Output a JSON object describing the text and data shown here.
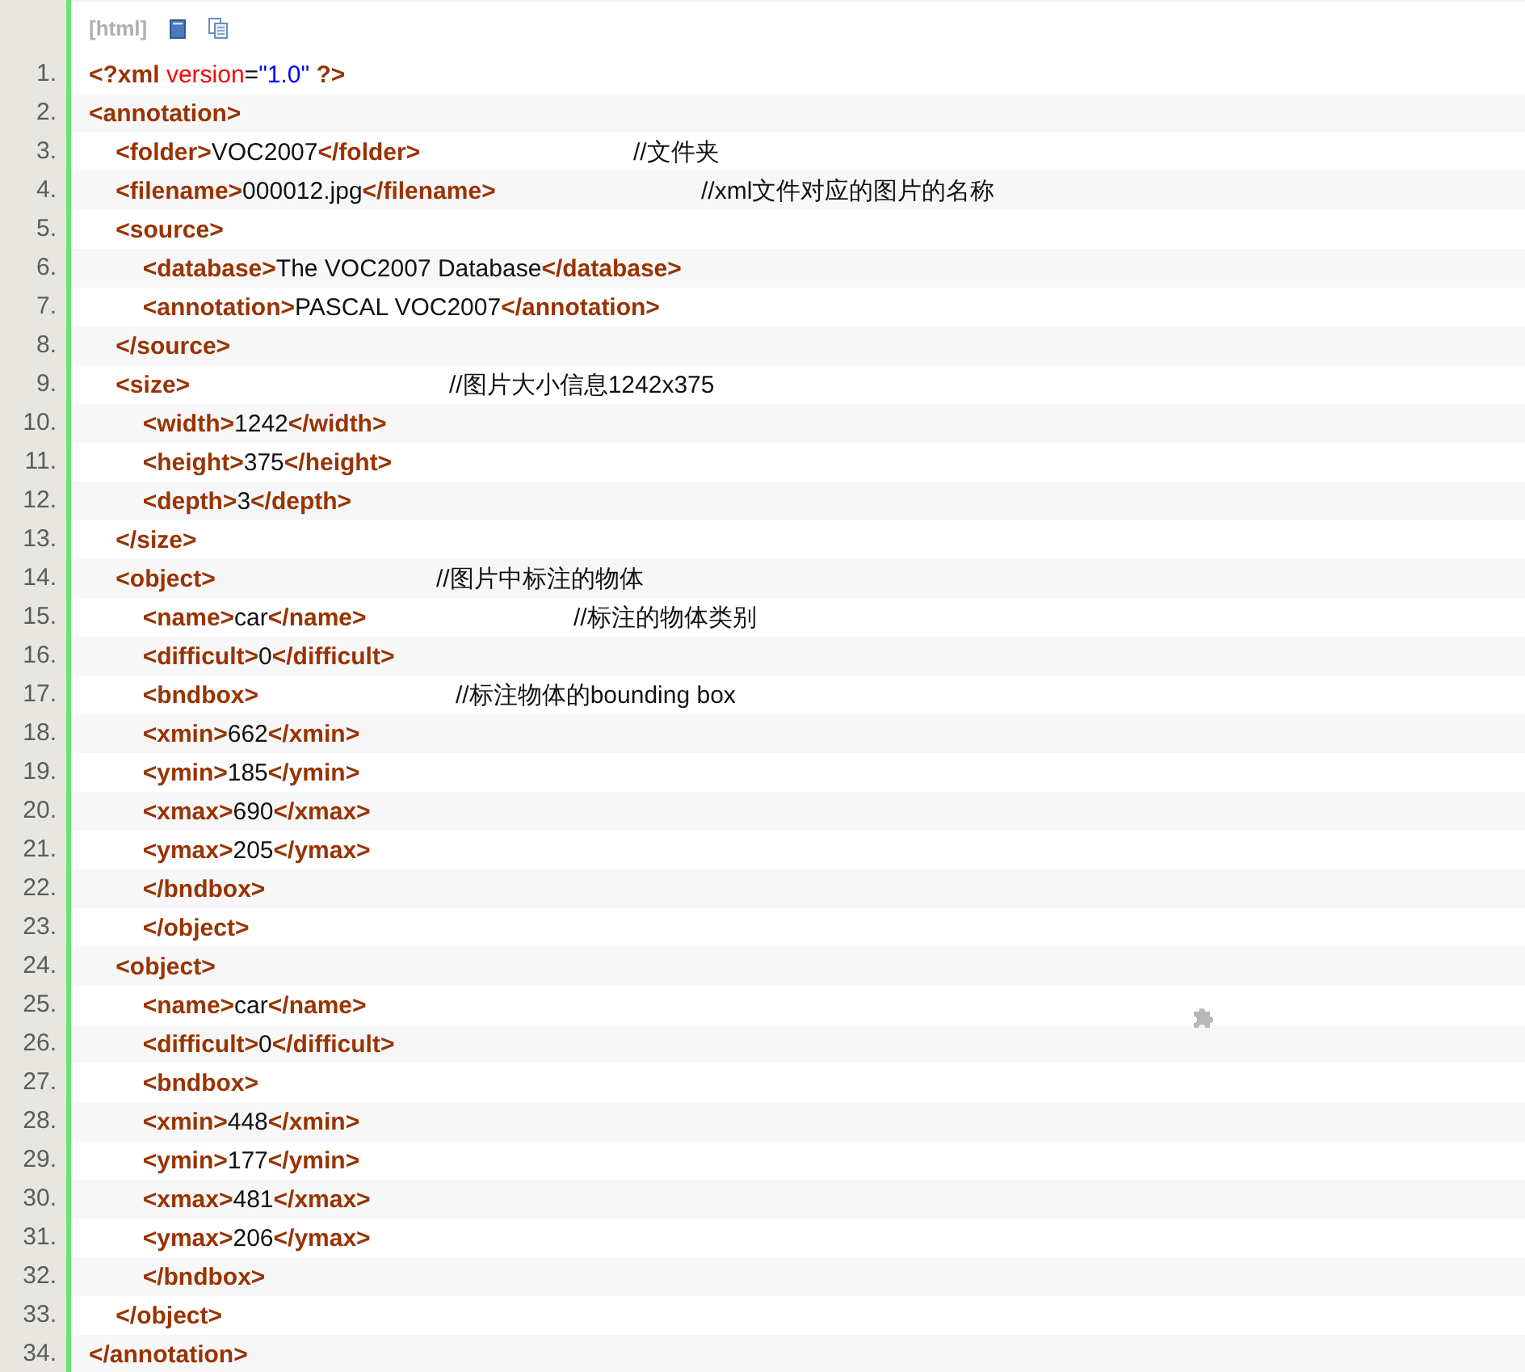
{
  "toolbar": {
    "language": "[html]"
  },
  "lines": [
    {
      "number": "1.",
      "code": [
        {
          "kind": "tag",
          "text": "<?xml "
        },
        {
          "kind": "attr",
          "text": "version"
        },
        {
          "kind": "plain",
          "text": "="
        },
        {
          "kind": "value",
          "text": "\"1.0\""
        },
        {
          "kind": "tag",
          "text": " ?>"
        }
      ]
    },
    {
      "number": "2.",
      "code": [
        {
          "kind": "tag",
          "text": "<annotation>"
        }
      ]
    },
    {
      "number": "3.",
      "code": [
        {
          "kind": "tag",
          "text": "    <folder>"
        },
        {
          "kind": "text",
          "text": "VOC2007"
        },
        {
          "kind": "tag",
          "text": "</folder>"
        }
      ],
      "comment": "//文件夹"
    },
    {
      "number": "4.",
      "code": [
        {
          "kind": "tag",
          "text": "    <filename>"
        },
        {
          "kind": "text",
          "text": "000012.jpg"
        },
        {
          "kind": "tag",
          "text": "</filename>"
        }
      ],
      "comment": "//xml文件对应的图片的名称"
    },
    {
      "number": "5.",
      "code": [
        {
          "kind": "tag",
          "text": "    <source>"
        }
      ]
    },
    {
      "number": "6.",
      "code": [
        {
          "kind": "tag",
          "text": "        <database>"
        },
        {
          "kind": "text",
          "text": "The VOC2007 Database"
        },
        {
          "kind": "tag",
          "text": "</database>"
        }
      ]
    },
    {
      "number": "7.",
      "code": [
        {
          "kind": "tag",
          "text": "        <annotation>"
        },
        {
          "kind": "text",
          "text": "PASCAL VOC2007"
        },
        {
          "kind": "tag",
          "text": "</annotation>"
        }
      ]
    },
    {
      "number": "8.",
      "code": [
        {
          "kind": "tag",
          "text": "    </source>"
        }
      ]
    },
    {
      "number": "9.",
      "code": [
        {
          "kind": "tag",
          "text": "    <size>"
        }
      ],
      "comment": "//图片大小信息1242x375"
    },
    {
      "number": "10.",
      "code": [
        {
          "kind": "tag",
          "text": "        <width>"
        },
        {
          "kind": "text",
          "text": "1242"
        },
        {
          "kind": "tag",
          "text": "</width>"
        }
      ]
    },
    {
      "number": "11.",
      "code": [
        {
          "kind": "tag",
          "text": "        <height>"
        },
        {
          "kind": "text",
          "text": "375"
        },
        {
          "kind": "tag",
          "text": "</height>"
        }
      ]
    },
    {
      "number": "12.",
      "code": [
        {
          "kind": "tag",
          "text": "        <depth>"
        },
        {
          "kind": "text",
          "text": "3"
        },
        {
          "kind": "tag",
          "text": "</depth>"
        }
      ]
    },
    {
      "number": "13.",
      "code": [
        {
          "kind": "tag",
          "text": "    </size>"
        }
      ]
    },
    {
      "number": "14.",
      "code": [
        {
          "kind": "tag",
          "text": "    <object>"
        }
      ],
      "comment": "//图片中标注的物体"
    },
    {
      "number": "15.",
      "code": [
        {
          "kind": "tag",
          "text": "        <name>"
        },
        {
          "kind": "text",
          "text": "car"
        },
        {
          "kind": "tag",
          "text": "</name>"
        }
      ],
      "comment": "//标注的物体类别"
    },
    {
      "number": "16.",
      "code": [
        {
          "kind": "tag",
          "text": "        <difficult>"
        },
        {
          "kind": "text",
          "text": "0"
        },
        {
          "kind": "tag",
          "text": "</difficult>"
        }
      ]
    },
    {
      "number": "17.",
      "code": [
        {
          "kind": "tag",
          "text": "        <bndbox>"
        }
      ],
      "comment": "//标注物体的bounding box"
    },
    {
      "number": "18.",
      "code": [
        {
          "kind": "tag",
          "text": "        <xmin>"
        },
        {
          "kind": "text",
          "text": "662"
        },
        {
          "kind": "tag",
          "text": "</xmin>"
        }
      ]
    },
    {
      "number": "19.",
      "code": [
        {
          "kind": "tag",
          "text": "        <ymin>"
        },
        {
          "kind": "text",
          "text": "185"
        },
        {
          "kind": "tag",
          "text": "</ymin>"
        }
      ]
    },
    {
      "number": "20.",
      "code": [
        {
          "kind": "tag",
          "text": "        <xmax>"
        },
        {
          "kind": "text",
          "text": "690"
        },
        {
          "kind": "tag",
          "text": "</xmax>"
        }
      ]
    },
    {
      "number": "21.",
      "code": [
        {
          "kind": "tag",
          "text": "        <ymax>"
        },
        {
          "kind": "text",
          "text": "205"
        },
        {
          "kind": "tag",
          "text": "</ymax>"
        }
      ]
    },
    {
      "number": "22.",
      "code": [
        {
          "kind": "tag",
          "text": "        </bndbox>"
        }
      ]
    },
    {
      "number": "23.",
      "code": [
        {
          "kind": "tag",
          "text": "        </object>"
        }
      ]
    },
    {
      "number": "24.",
      "code": [
        {
          "kind": "tag",
          "text": "    <object>"
        }
      ]
    },
    {
      "number": "25.",
      "code": [
        {
          "kind": "tag",
          "text": "        <name>"
        },
        {
          "kind": "text",
          "text": "car"
        },
        {
          "kind": "tag",
          "text": "</name>"
        }
      ]
    },
    {
      "number": "26.",
      "code": [
        {
          "kind": "tag",
          "text": "        <difficult>"
        },
        {
          "kind": "text",
          "text": "0"
        },
        {
          "kind": "tag",
          "text": "</difficult>"
        }
      ]
    },
    {
      "number": "27.",
      "code": [
        {
          "kind": "tag",
          "text": "        <bndbox>"
        }
      ]
    },
    {
      "number": "28.",
      "code": [
        {
          "kind": "tag",
          "text": "        <xmin>"
        },
        {
          "kind": "text",
          "text": "448"
        },
        {
          "kind": "tag",
          "text": "</xmin>"
        }
      ]
    },
    {
      "number": "29.",
      "code": [
        {
          "kind": "tag",
          "text": "        <ymin>"
        },
        {
          "kind": "text",
          "text": "177"
        },
        {
          "kind": "tag",
          "text": "</ymin>"
        }
      ]
    },
    {
      "number": "30.",
      "code": [
        {
          "kind": "tag",
          "text": "        <xmax>"
        },
        {
          "kind": "text",
          "text": "481"
        },
        {
          "kind": "tag",
          "text": "</xmax>"
        }
      ]
    },
    {
      "number": "31.",
      "code": [
        {
          "kind": "tag",
          "text": "        <ymax>"
        },
        {
          "kind": "text",
          "text": "206"
        },
        {
          "kind": "tag",
          "text": "</ymax>"
        }
      ]
    },
    {
      "number": "32.",
      "code": [
        {
          "kind": "tag",
          "text": "        </bndbox>"
        }
      ]
    },
    {
      "number": "33.",
      "code": [
        {
          "kind": "tag",
          "text": "    </object>"
        }
      ]
    },
    {
      "number": "34.",
      "code": [
        {
          "kind": "tag",
          "text": "</annotation>"
        }
      ]
    }
  ]
}
